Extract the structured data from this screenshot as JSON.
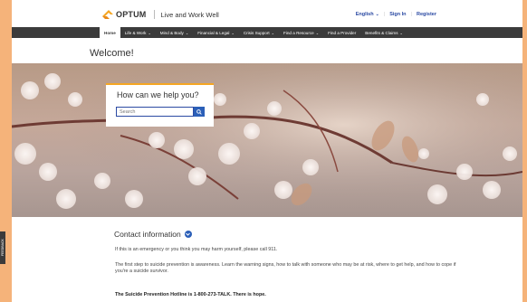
{
  "header": {
    "logo_text": "OPTUM",
    "tagline": "Live and Work Well",
    "language": "English",
    "sign_in": "Sign In",
    "register": "Register"
  },
  "nav": {
    "items": [
      "Home",
      "Life & Work",
      "Mind & Body",
      "Financial & Legal",
      "Crisis Support",
      "Find a Resource",
      "Find a Provider",
      "Benefits & Claims"
    ],
    "dropdowns": [
      false,
      true,
      true,
      true,
      true,
      true,
      false,
      true
    ]
  },
  "welcome": "Welcome!",
  "help": {
    "title": "How can we help you?",
    "search_placeholder": "Search"
  },
  "contact": {
    "title": "Contact information",
    "p1": "If this is an emergency or you think you may harm yourself, please call 911.",
    "p2": "The first step to suicide prevention is awareness. Learn the warning signs, how to talk with someone who may be at risk, where to get help, and how to cope if you're a suicide survivor.",
    "p3": "The Suicide Prevention Hotline is 1-800-273-TALK. There is hope."
  },
  "feedback_label": "FEEDBACK",
  "colors": {
    "accent_orange": "#f5a623",
    "link_blue": "#2b4aa3",
    "nav_dark": "#3b3b3b",
    "page_border": "#f5b37a"
  }
}
